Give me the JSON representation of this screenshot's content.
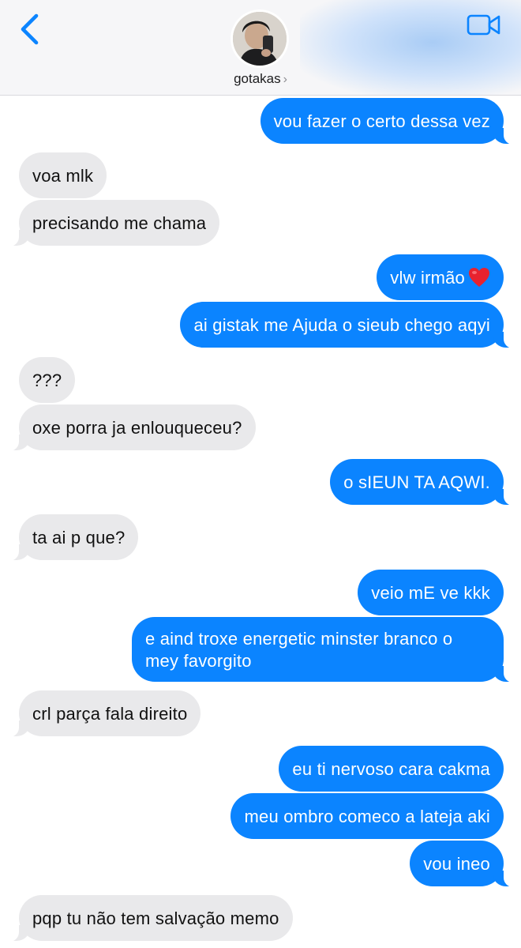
{
  "header": {
    "contact_name": "gotakas",
    "back_icon": "chevron-left-icon",
    "video_icon": "video-camera-icon",
    "accent_color": "#0b84ff"
  },
  "messages": [
    {
      "dir": "out",
      "text": "vou fazer o certo dessa vez"
    },
    {
      "dir": "in",
      "text": "voa mlk"
    },
    {
      "dir": "in",
      "text": "precisando me chama"
    },
    {
      "dir": "out",
      "text": "vlw irmão",
      "emoji": "red-heart"
    },
    {
      "dir": "out",
      "text": "ai gistak me Ajuda o sieub chego aqyi"
    },
    {
      "dir": "in",
      "text": "???"
    },
    {
      "dir": "in",
      "text": "oxe porra ja enlouqueceu?"
    },
    {
      "dir": "out",
      "text": "o sIEUN TA AQWI."
    },
    {
      "dir": "in",
      "text": "ta ai p que?"
    },
    {
      "dir": "out",
      "text": "veio mE ve kkk"
    },
    {
      "dir": "out",
      "text": "e aind troxe energetic minster branco o mey favorgito"
    },
    {
      "dir": "in",
      "text": "crl parça fala direito"
    },
    {
      "dir": "out",
      "text": "eu ti nervoso cara cakma"
    },
    {
      "dir": "out",
      "text": "meu ombro comeco a lateja aki"
    },
    {
      "dir": "out",
      "text": "vou ineo"
    },
    {
      "dir": "in",
      "text": "pqp tu não tem salvação memo"
    }
  ]
}
